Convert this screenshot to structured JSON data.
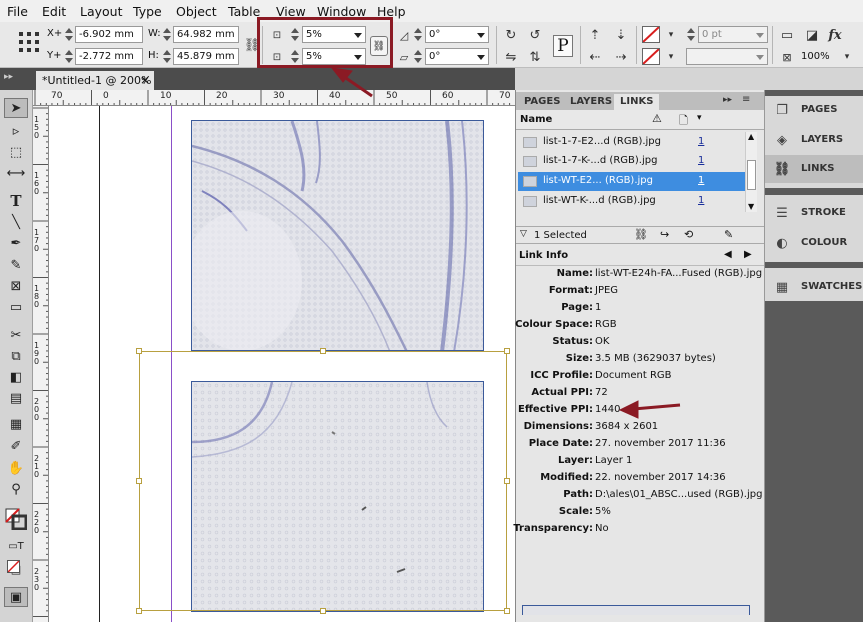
{
  "menu": [
    "File",
    "Edit",
    "Layout",
    "Type",
    "Object",
    "Table",
    "View",
    "Window",
    "Help"
  ],
  "control": {
    "x_label": "X+",
    "x_value": "-6.902 mm",
    "y_label": "Y+",
    "y_value": "-2.772 mm",
    "w_label": "W:",
    "w_value": "64.982 mm",
    "h_label": "H:",
    "h_value": "45.879 mm",
    "scale_x": "5%",
    "scale_y": "5%",
    "rotate": "0°",
    "shear": "0°",
    "stroke_weight": "0 pt",
    "zoom_pct": "100%"
  },
  "document_tab": {
    "title": "*Untitled-1 @ 200%",
    "close": "×"
  },
  "hruler": [
    "70",
    "0",
    "10",
    "20",
    "30",
    "40",
    "50",
    "60",
    "70"
  ],
  "vruler": [
    "150",
    "160",
    "170",
    "180",
    "190",
    "200",
    "210",
    "220",
    "230"
  ],
  "panel_tabs": [
    "PAGES",
    "LAYERS",
    "LINKS"
  ],
  "links_header": {
    "name_col": "Name"
  },
  "links": [
    {
      "name": "list-1-7-E2...d (RGB).jpg",
      "page": "1",
      "selected": false
    },
    {
      "name": "list-1-7-K-...d (RGB).jpg",
      "page": "1",
      "selected": false
    },
    {
      "name": "list-WT-E2... (RGB).jpg",
      "page": "1",
      "selected": true
    },
    {
      "name": "list-WT-K-...d (RGB).jpg",
      "page": "1",
      "selected": false
    }
  ],
  "links_status": "1 Selected",
  "link_info_title": "Link Info",
  "link_info": [
    {
      "key": "Name:",
      "value": "list-WT-E24h-FA...Fused (RGB).jpg"
    },
    {
      "key": "Format:",
      "value": "JPEG"
    },
    {
      "key": "Page:",
      "value": "1"
    },
    {
      "key": "Colour Space:",
      "value": "RGB"
    },
    {
      "key": "Status:",
      "value": "OK"
    },
    {
      "key": "Size:",
      "value": "3.5 MB (3629037 bytes)"
    },
    {
      "key": "ICC Profile:",
      "value": "Document RGB"
    },
    {
      "key": "Actual PPI:",
      "value": "72"
    },
    {
      "key": "Effective PPI:",
      "value": "1440"
    },
    {
      "key": "Dimensions:",
      "value": "3684 x 2601"
    },
    {
      "key": "Place Date:",
      "value": "27. november 2017 11:36"
    },
    {
      "key": "Layer:",
      "value": "Layer 1"
    },
    {
      "key": "Modified:",
      "value": "22. november 2017 14:36"
    },
    {
      "key": "Path:",
      "value": "D:\\ales\\01_ABSC...used (RGB).jpg"
    },
    {
      "key": "Scale:",
      "value": "5%"
    },
    {
      "key": "Transparency:",
      "value": "No"
    }
  ],
  "dock": [
    {
      "label": "PAGES",
      "icon": "pages-icon",
      "active": false
    },
    {
      "label": "LAYERS",
      "icon": "layers-icon",
      "active": false
    },
    {
      "label": "LINKS",
      "icon": "links-icon",
      "active": true
    },
    {
      "label": "STROKE",
      "icon": "stroke-icon",
      "active": false
    },
    {
      "label": "COLOUR",
      "icon": "colour-icon",
      "active": false
    },
    {
      "label": "SWATCHES",
      "icon": "swatches-icon",
      "active": false
    }
  ],
  "colors": {
    "annotation_red": "#8b1a24",
    "selection_blue": "#3e8de0",
    "frame_gold": "#b8a040"
  }
}
